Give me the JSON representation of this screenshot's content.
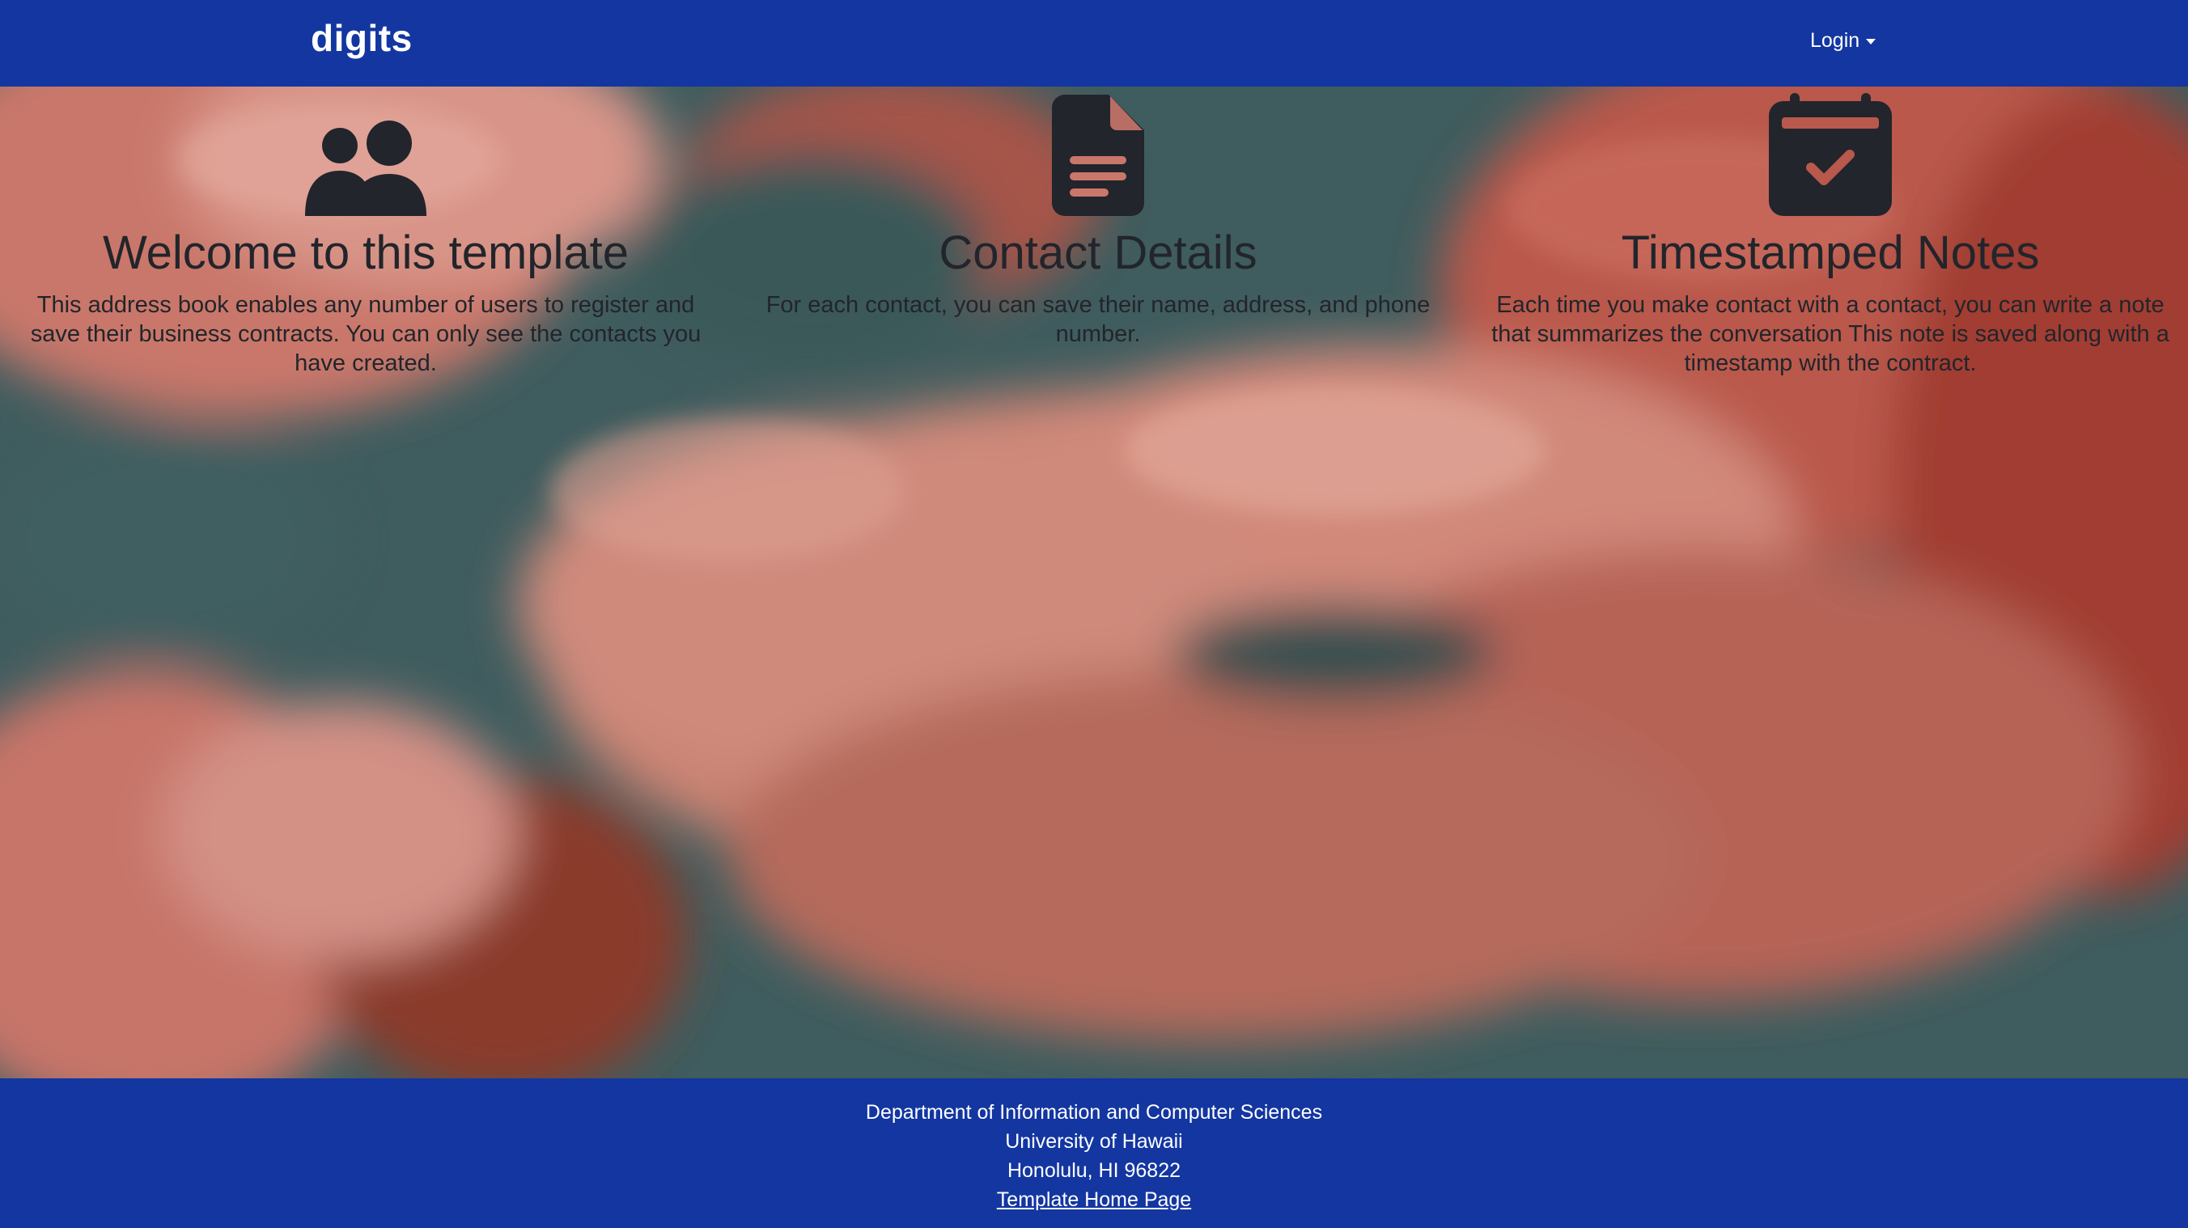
{
  "navbar": {
    "brand": "digits",
    "login_label": "Login",
    "background_color": "#1336a1"
  },
  "features": [
    {
      "icon": "users-icon",
      "title": "Welcome to this template",
      "text": "This address book enables any number of users to register and save their business contracts. You can only see the contacts you have created."
    },
    {
      "icon": "file-lines-icon",
      "title": "Contact Details",
      "text": "For each contact, you can save their name, address, and phone number."
    },
    {
      "icon": "calendar-check-icon",
      "title": "Timestamped Notes",
      "text": "Each time you make contact with a contact, you can write a note that summarizes the conversation This note is saved along with a timestamp with the contract."
    }
  ],
  "footer": {
    "line1": "Department of Information and Computer Sciences",
    "line2": "University of Hawaii",
    "line3": "Honolulu, HI 96822",
    "link_label": "Template Home Page"
  },
  "colors": {
    "text_dark": "#22252b",
    "cloud_pink": "#d4877a",
    "cloud_teal": "#3d5b5d",
    "cloud_red": "#a3463a"
  }
}
